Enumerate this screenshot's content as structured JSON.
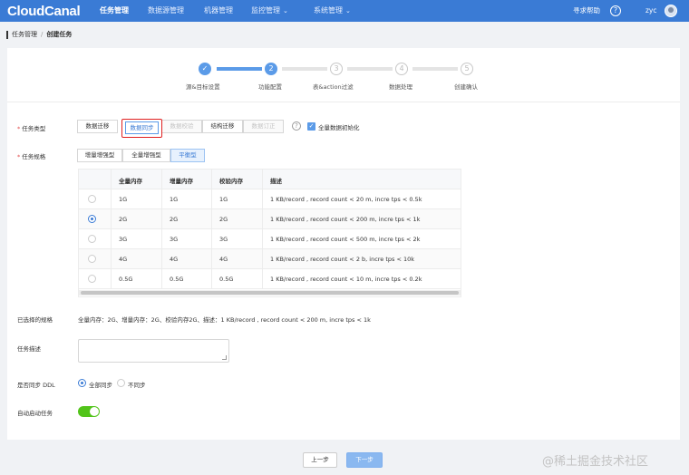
{
  "header": {
    "logo": "CloudCanal",
    "nav": [
      {
        "label": "任务管理",
        "has_chevron": false
      },
      {
        "label": "数据源管理",
        "has_chevron": false
      },
      {
        "label": "机器管理",
        "has_chevron": false
      },
      {
        "label": "监控管理",
        "has_chevron": true
      },
      {
        "label": "系统管理",
        "has_chevron": true
      }
    ],
    "chevron": "⌄",
    "help_label": "寻求帮助",
    "help_icon": "?",
    "user": "zyc",
    "brand_color": "#3a7bd5"
  },
  "breadcrumb": {
    "parent": "任务管理",
    "sep": "/",
    "current": "创建任务"
  },
  "steps": [
    {
      "num": "✓",
      "label": "源&目标设置",
      "status": "done"
    },
    {
      "num": "2",
      "label": "功能配置",
      "status": "active"
    },
    {
      "num": "3",
      "label": "表&action过滤",
      "status": "todo"
    },
    {
      "num": "4",
      "label": "数据处理",
      "status": "todo"
    },
    {
      "num": "5",
      "label": "创建确认",
      "status": "todo"
    }
  ],
  "form": {
    "required_mark": "*",
    "task_type": {
      "label": "任务类型",
      "options": [
        "数据迁移",
        "数据同步",
        "数据校验",
        "结构迁移",
        "数据订正"
      ],
      "selected": "数据同步",
      "help_icon": "?",
      "full_init_checked": true,
      "check_glyph": "✓",
      "full_init_label": "全量数据初始化"
    },
    "task_spec": {
      "label": "任务规格",
      "options": [
        "增量增强型",
        "全量增强型",
        "平衡型"
      ],
      "selected": "平衡型"
    },
    "spec_table": {
      "headers": [
        "全量内存",
        "增量内存",
        "校验内存",
        "描述"
      ],
      "rows": [
        {
          "full": "1G",
          "incr": "1G",
          "check": "1G",
          "desc": "1 KB/record , record count < 20 m, incre tps < 0.5k",
          "selected": false
        },
        {
          "full": "2G",
          "incr": "2G",
          "check": "2G",
          "desc": "1 KB/record , record count < 200 m, incre tps < 1k",
          "selected": true
        },
        {
          "full": "3G",
          "incr": "3G",
          "check": "3G",
          "desc": "1 KB/record , record count < 500 m, incre tps < 2k",
          "selected": false
        },
        {
          "full": "4G",
          "incr": "4G",
          "check": "4G",
          "desc": "1 KB/record , record count < 2 b, incre tps < 10k",
          "selected": false
        },
        {
          "full": "0.5G",
          "incr": "0.5G",
          "check": "0.5G",
          "desc": "1 KB/record , record count < 10 m, incre tps < 0.2k",
          "selected": false
        }
      ]
    },
    "selected_spec": {
      "label": "已选择的规格",
      "value": "全量内存：2G、增量内存：2G、校验内存2G、描述：1 KB/record , record count < 200 m, incre tps < 1k"
    },
    "description": {
      "label": "任务描述",
      "value": ""
    },
    "ddl_sync": {
      "label": "是否同步 DDL",
      "options": [
        "全部同步",
        "不同步"
      ],
      "selected": "全部同步"
    },
    "auto_start": {
      "label": "自动启动任务",
      "on": true
    }
  },
  "footer": {
    "prev_label": "上一步",
    "next_label": "下一步",
    "watermark": "@稀土掘金技术社区"
  }
}
